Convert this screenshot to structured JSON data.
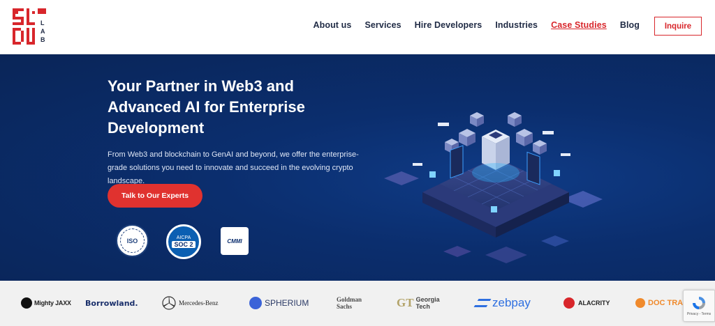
{
  "header": {
    "logo_text_a": "SL",
    "logo_text_b": "DU",
    "logo_text_c": "LAB",
    "nav": [
      {
        "label": "About us"
      },
      {
        "label": "Services"
      },
      {
        "label": "Hire Developers"
      },
      {
        "label": "Industries"
      },
      {
        "label": "Case Studies"
      },
      {
        "label": "Blog"
      }
    ],
    "inquire_label": "Inquire"
  },
  "hero": {
    "title": "Your Partner in Web3 and Advanced AI for Enterprise Development",
    "subtitle": "From Web3 and blockchain to GenAI and beyond, we offer the enterprise-grade solutions you need to innovate and succeed in the evolving crypto landscape.",
    "cta_label": "Talk to Our Experts",
    "badges": {
      "iso": "ISO",
      "soc_top": "AICPA",
      "soc_main": "SOC 2",
      "cmmi": "CMMI"
    }
  },
  "clients": [
    {
      "name": "Mighty JAXX"
    },
    {
      "name": "Borrowland."
    },
    {
      "name": "Mercedes-Benz"
    },
    {
      "name": "SPHERIUM"
    },
    {
      "name": "Goldman Sachs"
    },
    {
      "name": "Georgia Tech"
    },
    {
      "name": "zebpay"
    },
    {
      "name": "ALACRITY"
    },
    {
      "name": "DOC TRA"
    }
  ],
  "recaptcha": {
    "label": "Privacy - Terms"
  },
  "colors": {
    "brand_red": "#d8262b",
    "hero_bg": "#0b2e6e",
    "nav_text": "#1f2a44"
  }
}
